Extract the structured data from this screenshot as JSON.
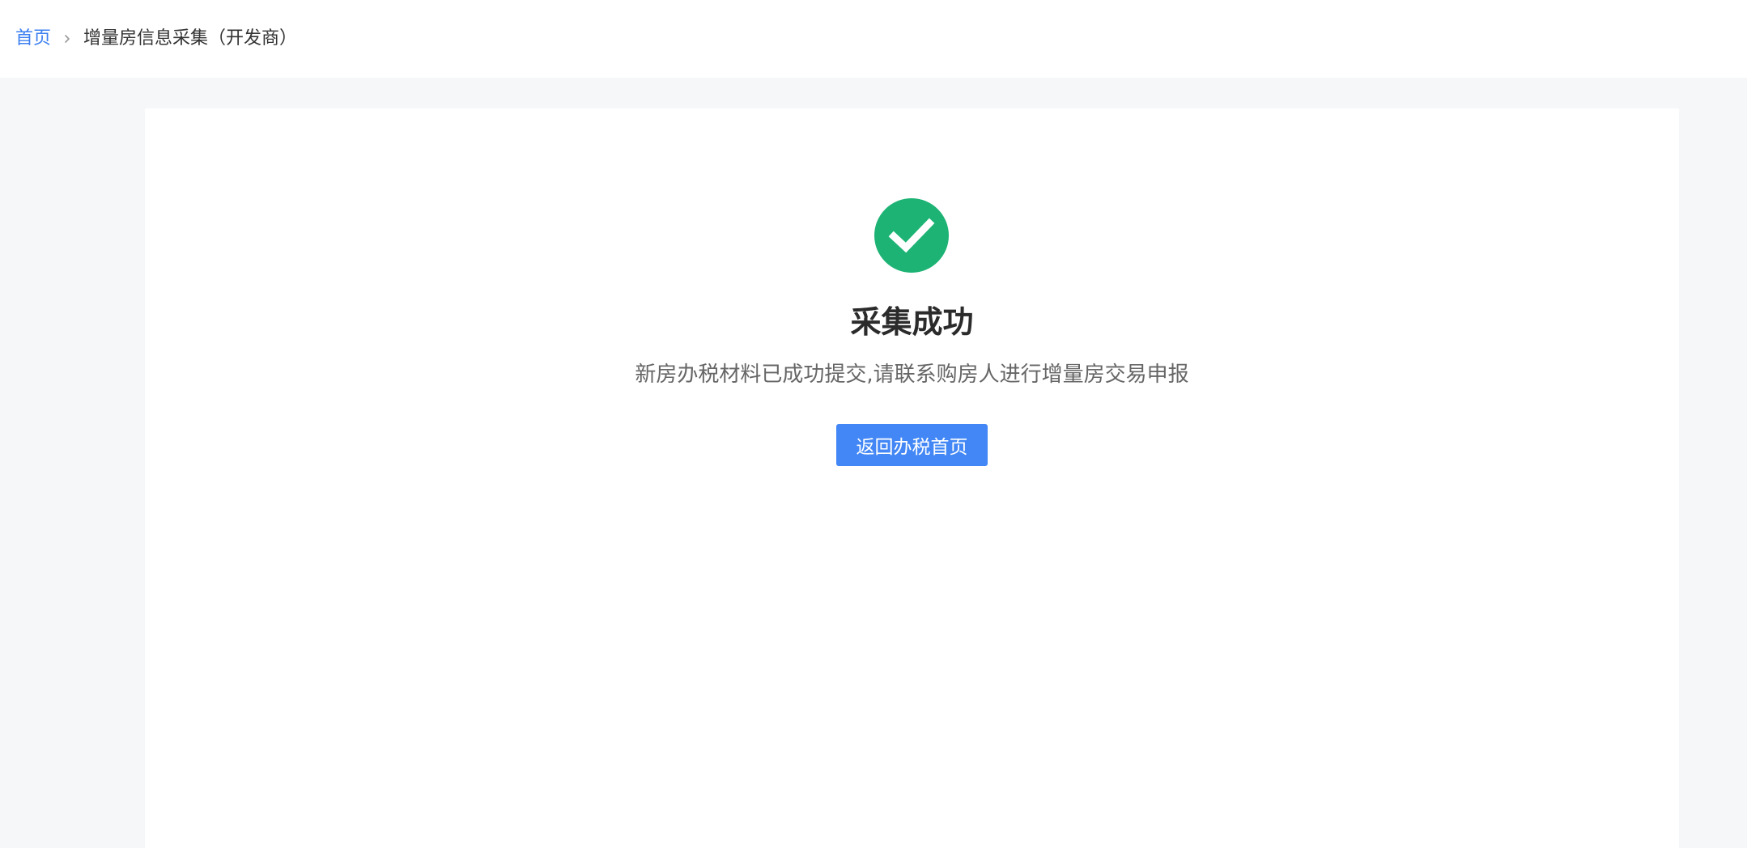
{
  "breadcrumb": {
    "home_label": "首页",
    "current_label": "增量房信息采集（开发商）"
  },
  "result": {
    "status": "success",
    "icon": "check-circle-icon",
    "title": "采集成功",
    "description": "新房办税材料已成功提交,请联系购房人进行增量房交易申报",
    "button_label": "返回办税首页"
  },
  "colors": {
    "accent": "#4287f5",
    "link": "#3c7ff0",
    "success": "#1db374",
    "background": "#f6f7f9",
    "title": "#2b2b2b",
    "description": "#666666"
  }
}
